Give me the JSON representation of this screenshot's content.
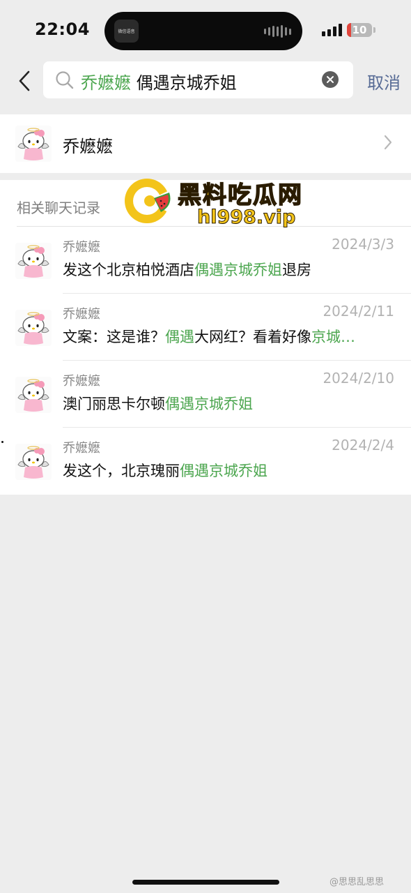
{
  "status_bar": {
    "time": "22:04",
    "battery_level": "10",
    "island_app_text": "微信语音"
  },
  "search": {
    "query_highlight": "乔嬷嬷",
    "query_rest": " 偶遇京城乔姐",
    "cancel_label": "取消"
  },
  "contact": {
    "name": "乔嬷嬷"
  },
  "history": {
    "section_title": "相关聊天记录",
    "items": [
      {
        "sender": "乔嬷嬷",
        "date": "2024/3/3",
        "segments": [
          {
            "text": "发这个北京柏悦酒店",
            "hl": false
          },
          {
            "text": "偶遇京城乔姐",
            "hl": true
          },
          {
            "text": "退房",
            "hl": false
          }
        ]
      },
      {
        "sender": "乔嬷嬷",
        "date": "2024/2/11",
        "segments": [
          {
            "text": "文案：这是谁？",
            "hl": false
          },
          {
            "text": "偶遇",
            "hl": true
          },
          {
            "text": "大网红？看着好像",
            "hl": false
          },
          {
            "text": "京城…",
            "hl": true
          }
        ]
      },
      {
        "sender": "乔嬷嬷",
        "date": "2024/2/10",
        "segments": [
          {
            "text": "澳门丽思卡尔顿",
            "hl": false
          },
          {
            "text": "偶遇京城乔姐",
            "hl": true
          }
        ]
      },
      {
        "sender": "乔嬷嬷",
        "date": "2024/2/4",
        "segments": [
          {
            "text": "发这个，北京瑰丽",
            "hl": false
          },
          {
            "text": "偶遇京城乔姐",
            "hl": true
          }
        ]
      }
    ]
  },
  "watermark": {
    "title": "黑料吃瓜网",
    "url": "hl998.vip"
  },
  "credit": "@思思乱思思",
  "colors": {
    "highlight": "#4ca64f",
    "link": "#576b95",
    "background": "#ededed"
  }
}
